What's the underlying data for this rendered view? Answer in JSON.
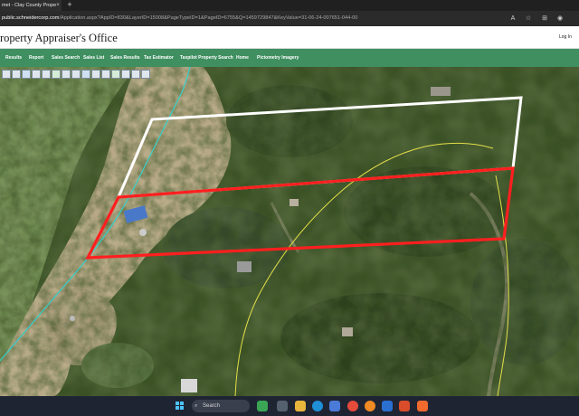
{
  "browser": {
    "tab_title": "met - Clay County Prope",
    "tab_close": "×",
    "new_tab": "+",
    "url_host": "public.schneidercorp.com",
    "url_path": "/Application.aspx?AppID=830&LayerID=15008&PageTypeID=1&PageID=6755&Q=1459729847&KeyValue=31-06-24-007651-044-00",
    "icons": [
      "read-aloud-icon",
      "favorite-icon",
      "extensions-icon",
      "profile-icon"
    ]
  },
  "header": {
    "title": "roperty Appraiser's Office",
    "login": "Log In"
  },
  "nav": {
    "items": [
      "Results",
      "Report",
      "Sales Search",
      "Sales List",
      "Sales Results",
      "Tax Estimator",
      "Taxpilot Property Search",
      "Home",
      "Pictometry Imagery"
    ]
  },
  "map": {
    "colors": {
      "parcel_outline": "#ff1f1f",
      "adjacent_outline": "#ffffff",
      "line_yellow": "#e6e04a",
      "line_cyan": "#33d1cc"
    },
    "toolbar_icons": [
      "zoom-in-icon",
      "zoom-out-icon",
      "pan-icon",
      "identify-icon",
      "measure-icon",
      "layers-icon",
      "print-icon",
      "full-extent-icon",
      "previous-extent-icon",
      "next-extent-icon",
      "select-icon",
      "clear-icon",
      "help-icon",
      "overview-icon",
      "close-icon"
    ]
  },
  "taskbar": {
    "search_label": "Search",
    "apps": [
      "widgets-icon",
      "task-view-icon",
      "file-explorer-icon",
      "edge-icon",
      "store-icon",
      "chrome-icon",
      "firefox-icon",
      "mail-icon",
      "office-icon",
      "brave-icon"
    ]
  }
}
